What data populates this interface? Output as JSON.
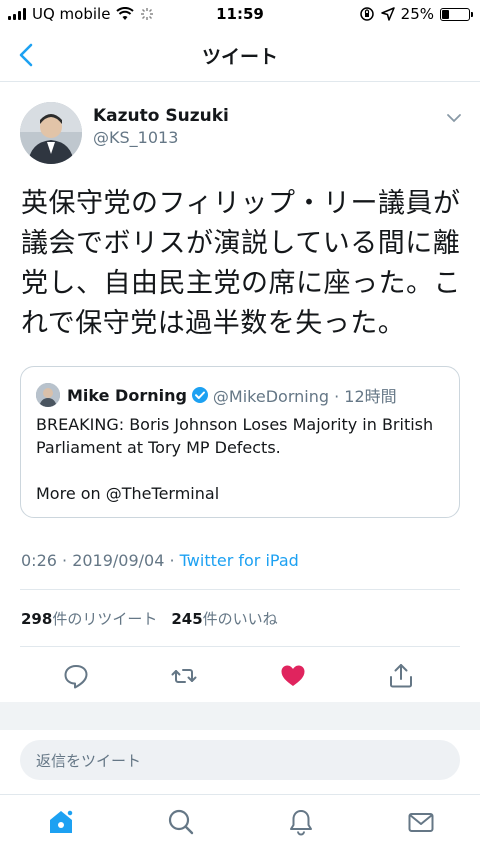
{
  "status_bar": {
    "carrier": "UQ mobile",
    "time": "11:59",
    "battery_percent": "25%",
    "battery_level": 0.25
  },
  "nav": {
    "title": "ツイート"
  },
  "tweet": {
    "author_name": "Kazuto Suzuki",
    "author_handle": "@KS_1013",
    "text": "英保守党のフィリップ・リー議員が議会でボリスが演説している間に離党し、自由民主党の席に座った。これで保守党は過半数を失った。",
    "timestamp": "0:26 · 2019/09/04 · ",
    "source": "Twitter for iPad",
    "retweet_count": "298",
    "retweet_label": "件のリツイート",
    "like_count": "245",
    "like_label": "件のいいね"
  },
  "quote": {
    "name": "Mike Dorning",
    "handle_time": "@MikeDorning · 12時間",
    "body": "BREAKING: Boris Johnson Loses Majority in British Parliament  at Tory MP Defects.",
    "more": "More on @TheTerminal"
  },
  "reply": {
    "placeholder": "返信をツイート"
  },
  "colors": {
    "accent": "#1da1f2",
    "like": "#e0245e",
    "text": "#14171a",
    "muted": "#657786"
  },
  "icons": [
    "back-chevron-icon",
    "caret-down-icon",
    "verified-icon",
    "reply-icon",
    "retweet-icon",
    "heart-icon",
    "share-icon",
    "home-icon",
    "search-icon",
    "bell-icon",
    "mail-icon"
  ]
}
